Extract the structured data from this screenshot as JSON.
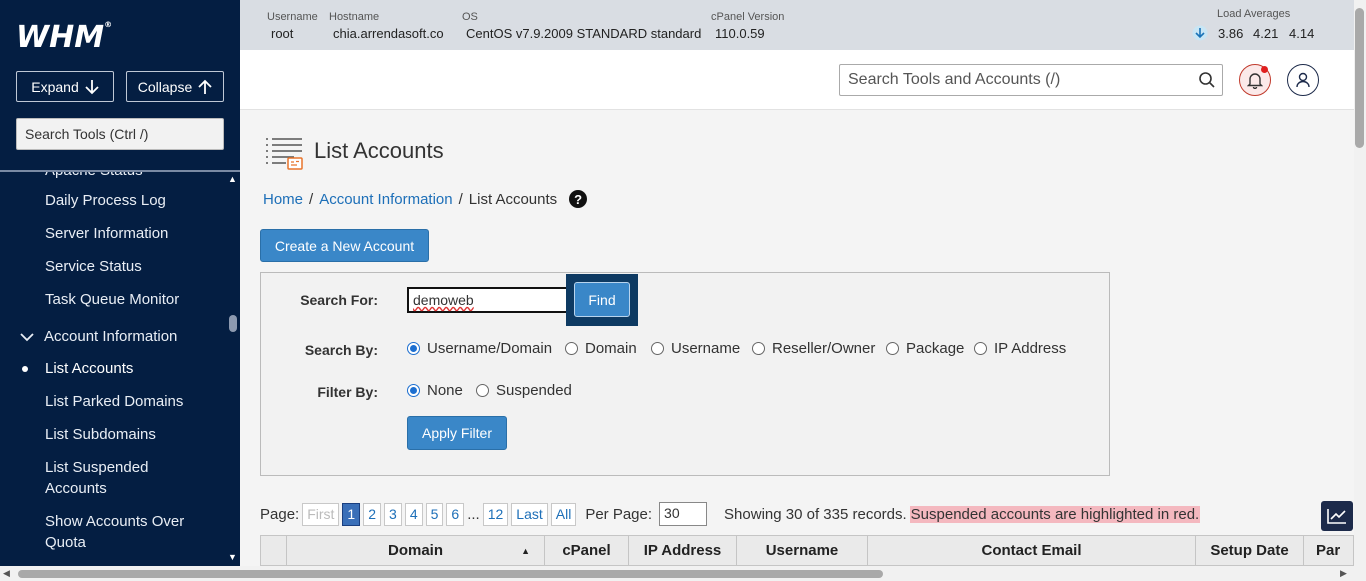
{
  "sidebar": {
    "logo": "WHM",
    "logo_mark": "®",
    "expand_label": "Expand",
    "collapse_label": "Collapse",
    "search_placeholder": "Search Tools (Ctrl /)",
    "items": [
      {
        "label": "Apache Status"
      },
      {
        "label": "Daily Process Log"
      },
      {
        "label": "Server Information"
      },
      {
        "label": "Service Status"
      },
      {
        "label": "Task Queue Monitor"
      },
      {
        "label": "Account Information"
      },
      {
        "label": "List Accounts"
      },
      {
        "label": "List Parked Domains"
      },
      {
        "label": "List Subdomains"
      },
      {
        "label": "List Suspended"
      },
      {
        "label": "Accounts"
      },
      {
        "label": "Show Accounts Over"
      },
      {
        "label": "Quota"
      }
    ]
  },
  "topbar": {
    "username_label": "Username",
    "username": "root",
    "hostname_label": "Hostname",
    "hostname": "chia.arrendasoft.co",
    "os_label": "OS",
    "os": "CentOS v7.9.2009 STANDARD standard",
    "cpanel_label": "cPanel Version",
    "cpanel_version": "110.0.59",
    "load_label": "Load Averages",
    "load_1": "3.86",
    "load_5": "4.21",
    "load_15": "4.14"
  },
  "header": {
    "search_placeholder": "Search Tools and Accounts (/)"
  },
  "page": {
    "title": "List Accounts",
    "breadcrumb": [
      "Home",
      "Account Information",
      "List Accounts"
    ],
    "breadcrumb_sep": "/",
    "create_label": "Create a New Account"
  },
  "filter": {
    "search_for_label": "Search For:",
    "search_value": "demoweb",
    "find_label": "Find",
    "search_by_label": "Search By:",
    "search_by_options": [
      "Username/Domain",
      "Domain",
      "Username",
      "Reseller/Owner",
      "Package",
      "IP Address"
    ],
    "search_by_selected": "Username/Domain",
    "filter_by_label": "Filter By:",
    "filter_by_options": [
      "None",
      "Suspended"
    ],
    "filter_by_selected": "None",
    "apply_label": "Apply Filter"
  },
  "pager": {
    "page_label": "Page:",
    "first": "First",
    "pages": [
      "1",
      "2",
      "3",
      "4",
      "5",
      "6"
    ],
    "current": "1",
    "ellipsis": "...",
    "last_page": "12",
    "last": "Last",
    "all": "All",
    "per_page_label": "Per Page:",
    "per_page": "30",
    "showing": "Showing 30 of 335 records.",
    "suspended_note": "Suspended accounts are highlighted in red."
  },
  "table": {
    "columns": [
      "",
      "Domain",
      "cPanel",
      "IP Address",
      "Username",
      "Contact Email",
      "Setup Date",
      "Par"
    ]
  },
  "colors": {
    "sidebar_bg": "#041e42",
    "accent": "#3a87c8",
    "suspended_highlight": "#f4b8bf"
  }
}
